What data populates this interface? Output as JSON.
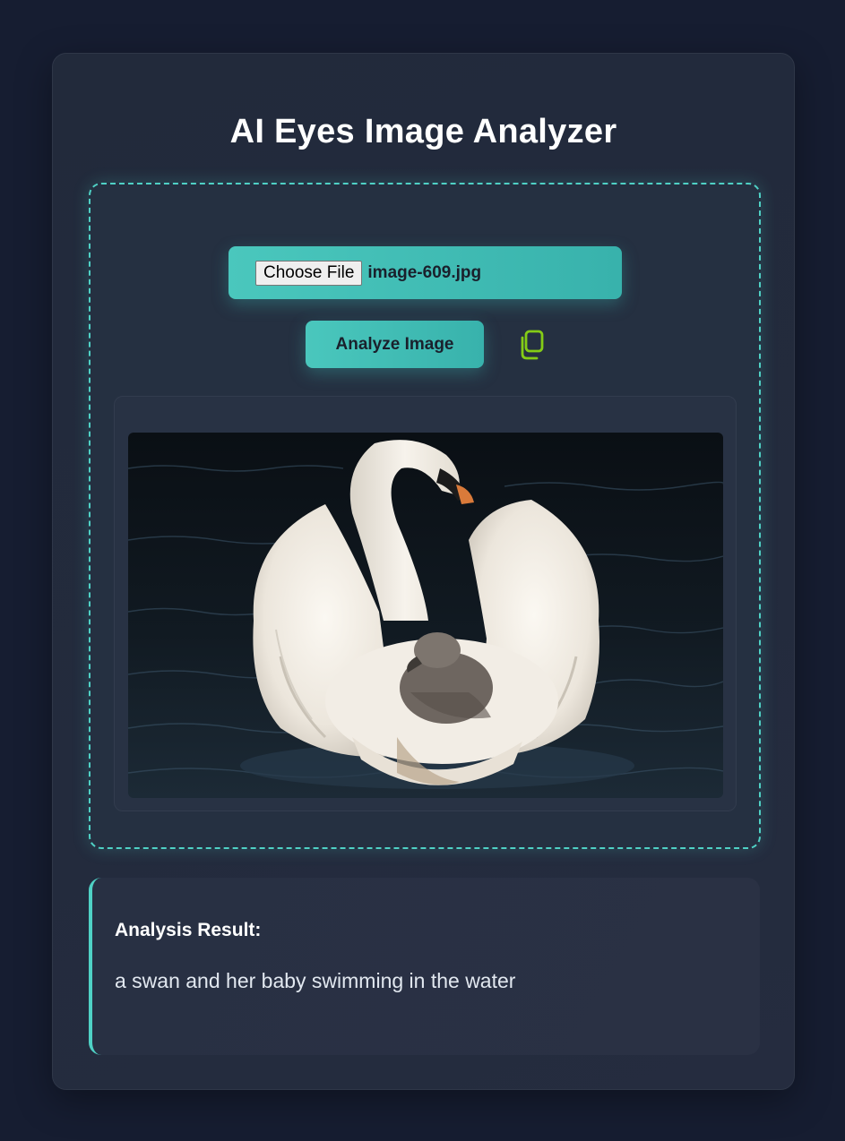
{
  "app": {
    "title": "AI Eyes Image Analyzer"
  },
  "upload": {
    "choose_file_label": "Choose File",
    "file_name": "image-609.jpg",
    "analyze_label": "Analyze Image"
  },
  "icons": {
    "copy": "copy-icon"
  },
  "preview": {
    "subject": "swan-with-cygnet-photo"
  },
  "result": {
    "heading": "Analysis Result:",
    "text": "a swan and her baby swimming in the water"
  },
  "colors": {
    "accent": "#4fd1c5",
    "button": "#38b2ac",
    "copy_icon": "#84cc16",
    "background": "#161d31",
    "card": "#232b3d"
  }
}
